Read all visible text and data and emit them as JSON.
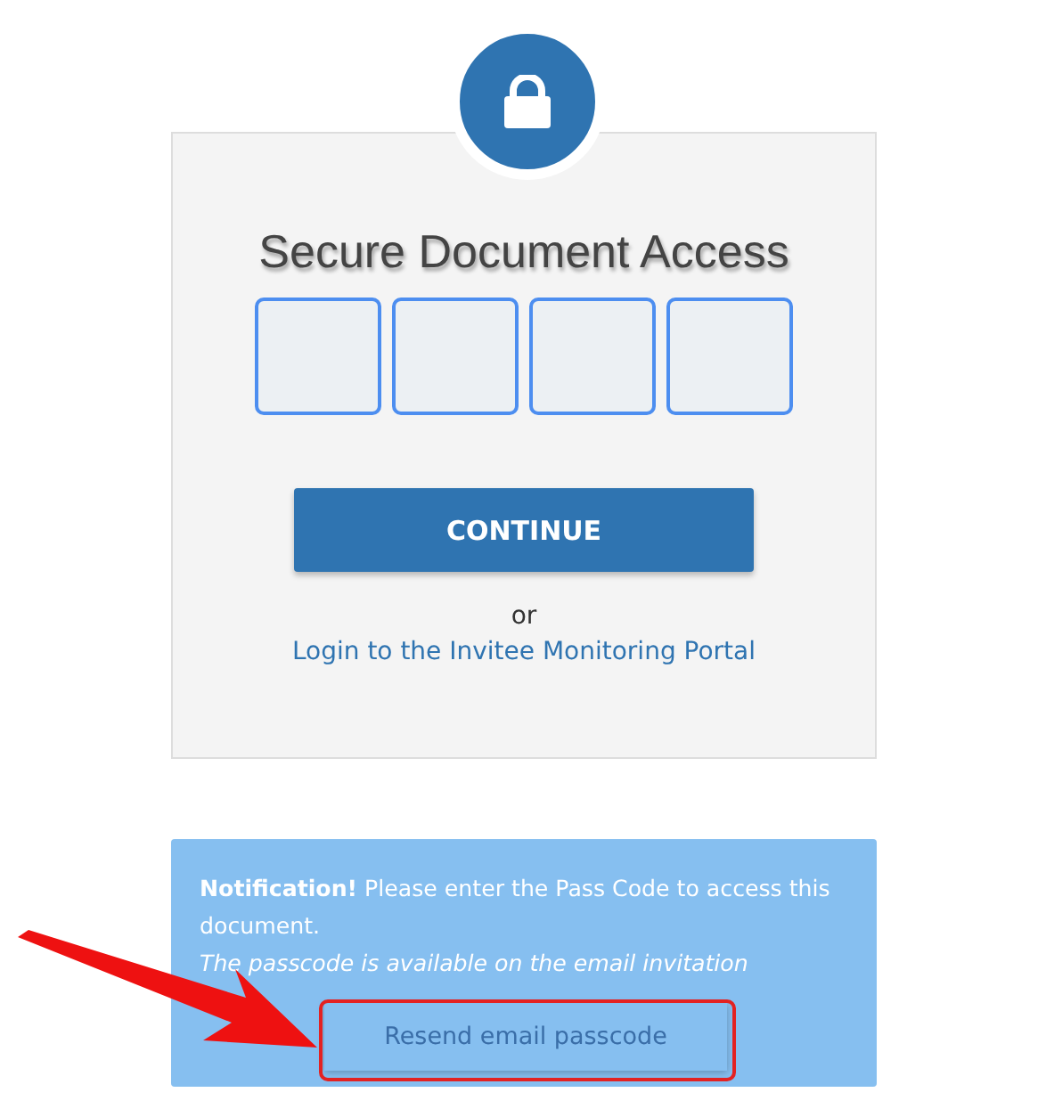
{
  "card": {
    "title": "Secure Document Access",
    "pin_boxes": [
      {
        "kind": "digit"
      },
      {
        "kind": "digit"
      },
      {
        "kind": "digit"
      },
      {
        "kind": "digit"
      }
    ],
    "continue_button": "CONTINUE",
    "separator": "or",
    "portal_link": "Login to the Invitee Monitoring Portal"
  },
  "notification": {
    "text": "**Notification!** Please enter the Pass Code to access this document.",
    "note": "The passcode is available on the email invitation",
    "resend_button": "Resend email passcode"
  },
  "annotations": {
    "pointer_arrow": true,
    "highlight_frame": true
  }
}
